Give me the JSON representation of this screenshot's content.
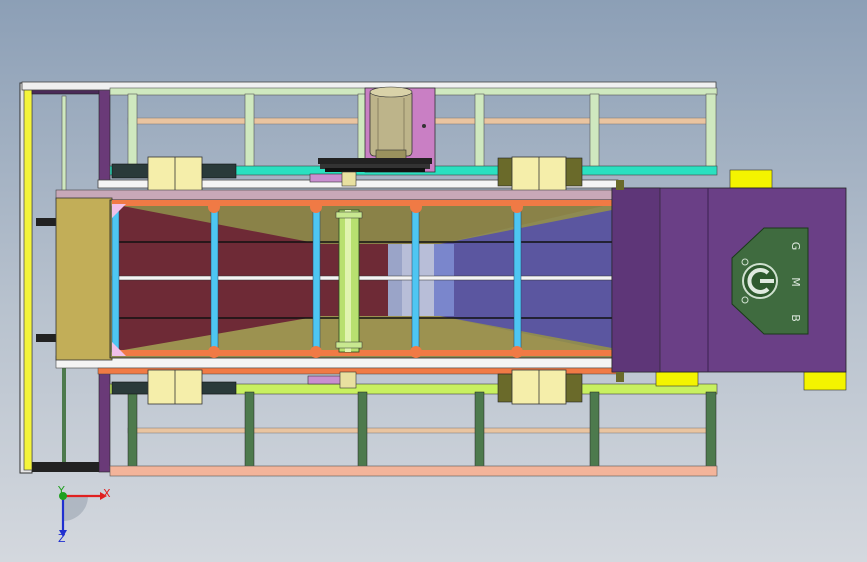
{
  "viewport": {
    "background_top": "#8c9fb6",
    "background_bottom": "#d4d8de"
  },
  "triad": {
    "x_label": "X",
    "y_label": "Y",
    "z_label": "Z",
    "x_color": "#e02020",
    "y_color": "#20a020",
    "z_color": "#2030d0"
  },
  "logo": {
    "letters": [
      "G",
      "M",
      "B"
    ]
  },
  "colors": {
    "frame_light_green": "#cfe8bf",
    "frame_dark_green": "#4d7a4d",
    "frame_peach": "#f3b49a",
    "frame_purple": "#6a3a78",
    "rail_yellow": "#f4f43a",
    "housing_purple": "#6a3f86",
    "bearing_cream": "#f5eeaa",
    "tank_olive": "#9c8c48",
    "column_cyan": "#4ec6f2",
    "node_orange": "#f07a45",
    "motor_pink": "#c97fc4",
    "logo_green": "#3f6b3f"
  }
}
